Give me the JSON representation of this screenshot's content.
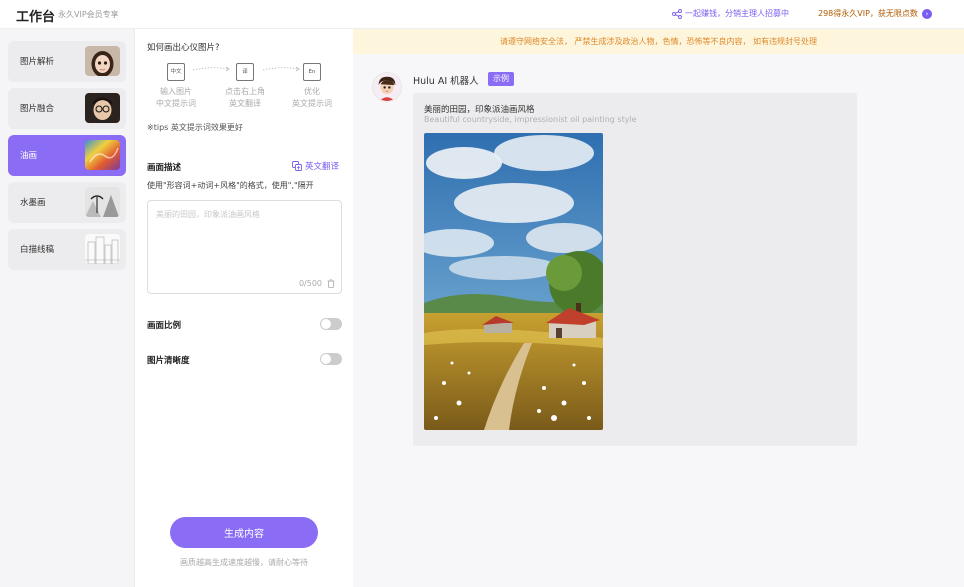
{
  "header": {
    "title": "工作台",
    "subtitle": "永久VIP会员专享",
    "share_text": "一起赚钱，分销主理人招募中",
    "vip_text": "298得永久VIP，获无限点数"
  },
  "sidebar": {
    "items": [
      {
        "label": "图片解析",
        "active": false,
        "thumb": "girl-portrait"
      },
      {
        "label": "图片融合",
        "active": false,
        "thumb": "boy-glasses-portrait"
      },
      {
        "label": "油画",
        "active": true,
        "thumb": "colorful-oil-painting"
      },
      {
        "label": "水墨画",
        "active": false,
        "thumb": "ink-landscape"
      },
      {
        "label": "白描线稿",
        "active": false,
        "thumb": "line-sketch-city"
      }
    ]
  },
  "panel": {
    "question": "如何画出心仪图片?",
    "steps": [
      {
        "icon_text": "中文",
        "icon": "chinese-text-icon",
        "text": "输入图片\n中文提示词"
      },
      {
        "icon_text": "译",
        "icon": "translate-icon",
        "text": "点击右上角\n英文翻译"
      },
      {
        "icon_text": "En",
        "icon": "edit-english-icon",
        "text": "优化\n英文提示词"
      }
    ],
    "tips": "※tips   英文提示词效果更好",
    "desc_title": "画面描述",
    "translate_label": "英文翻译",
    "desc_hint": "使用\"形容词+动词+风格\"的格式，使用\",\"隔开",
    "prompt_placeholder": "美丽的田园，印象派油画风格",
    "counter": "0/500",
    "ratio_label": "画面比例",
    "clarity_label": "图片清晰度",
    "ratio_on": false,
    "clarity_on": false,
    "generate_label": "生成内容",
    "generate_note": "画质越高生成速度越慢，请耐心等待"
  },
  "main": {
    "notice": "请遵守网络安全法，  严禁生成涉及政治人物，色情，恐怖等不良内容，  如有违规封号处理",
    "bot_name": "Hulu AI 机器人",
    "tag": "示例",
    "prompt_cn": "美丽的田园，印象派油画风格",
    "prompt_en": "Beautiful countryside, impressionist oil painting style"
  },
  "colors": {
    "accent": "#8a6cf5",
    "notice_bg": "#fdf6dc",
    "notice_text": "#e0882a",
    "vip_text": "#b05a00"
  }
}
